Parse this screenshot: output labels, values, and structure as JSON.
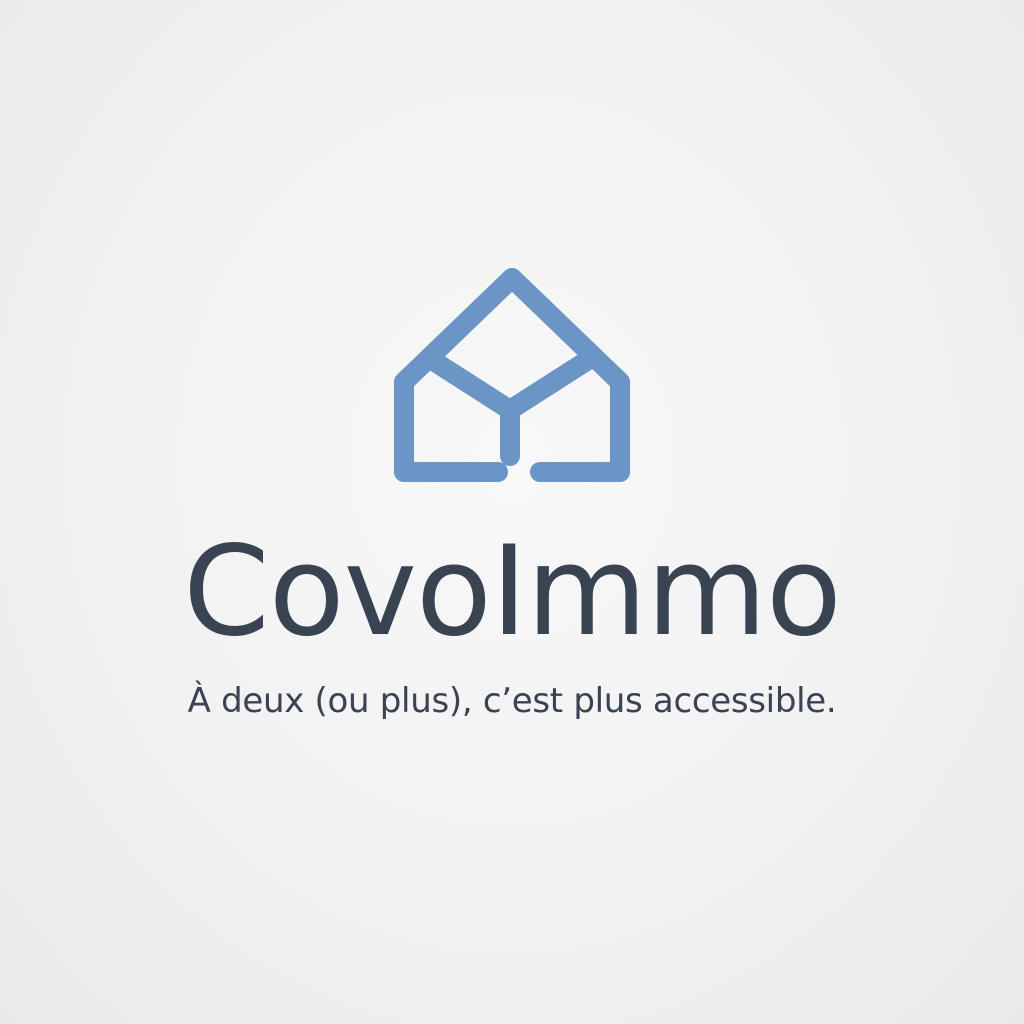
{
  "brand": {
    "name": "CovoImmo",
    "tagline": "À deux (ou plus), c’est plus accessible.",
    "logo_icon": "house-logo-icon",
    "colors": {
      "mark": "#6b95c4",
      "text": "#394352",
      "background": "#f3f3f4"
    }
  }
}
